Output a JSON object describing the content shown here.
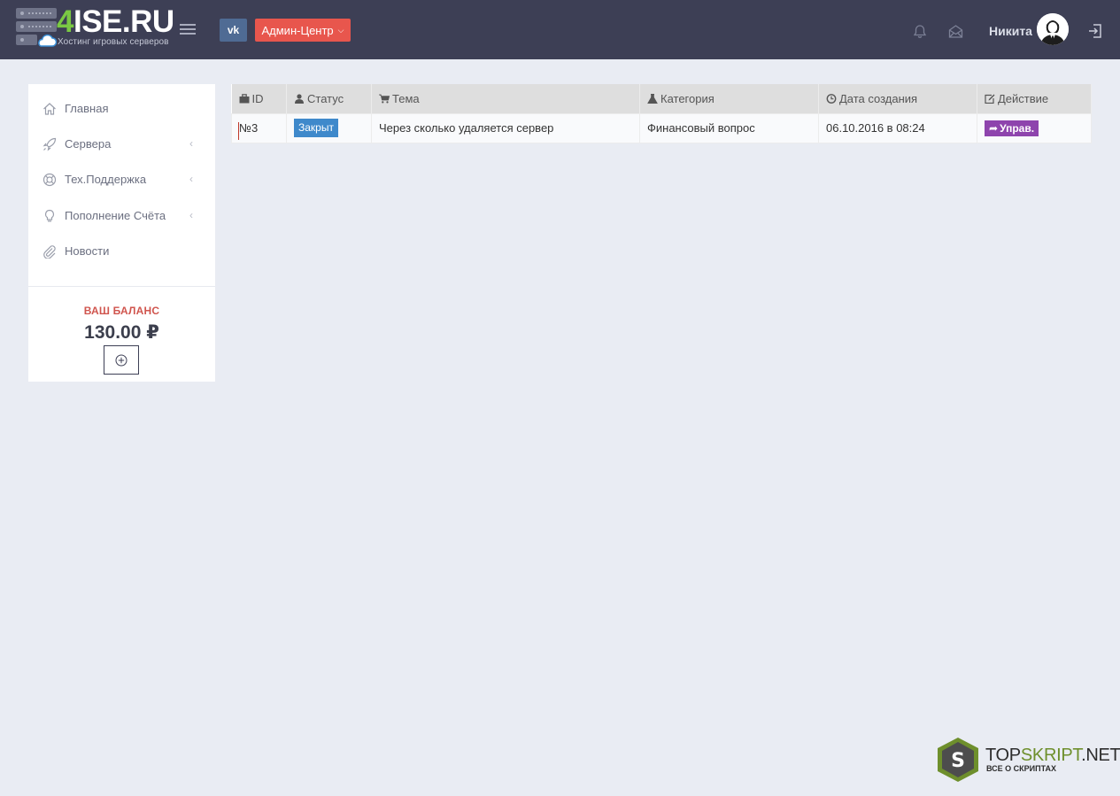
{
  "header": {
    "logo": {
      "brand_four": "4",
      "brand_rest": "ISE.RU",
      "tagline": "Хостинг игровых серверов"
    },
    "vk_label": "vk",
    "admin_label": "Админ-Центр",
    "username": "Никита"
  },
  "sidebar": {
    "items": [
      {
        "label": "Главная",
        "icon": "home-icon",
        "has_arrow": false
      },
      {
        "label": "Сервера",
        "icon": "rocket-icon",
        "has_arrow": true
      },
      {
        "label": "Тех.Поддержка",
        "icon": "lifebuoy-icon",
        "has_arrow": true
      },
      {
        "label": "Пополнение Счёта",
        "icon": "lightbulb-icon",
        "has_arrow": true
      },
      {
        "label": "Новости",
        "icon": "paperclip-icon",
        "has_arrow": false
      }
    ],
    "arrow_glyph": "‹",
    "balance_label": "ВАШ БАЛАНС",
    "balance_amount": "130.00 ₽",
    "add_glyph": "⊕"
  },
  "table": {
    "columns": [
      {
        "label": "ID",
        "icon": "briefcase-icon"
      },
      {
        "label": "Статус",
        "icon": "user-icon"
      },
      {
        "label": "Тема",
        "icon": "cart-icon"
      },
      {
        "label": "Категория",
        "icon": "flask-icon"
      },
      {
        "label": "Дата создания",
        "icon": "clock-icon"
      },
      {
        "label": "Действие",
        "icon": "edit-icon"
      }
    ],
    "rows": [
      {
        "id": "№3",
        "status": "Закрыт",
        "subject": "Через сколько удаляется сервер",
        "category": "Финансовый вопрос",
        "created": "06.10.2016 в 08:24",
        "action": "Управ."
      }
    ]
  },
  "watermark": {
    "title_main": "TOP",
    "title_accent": "SKRIPT",
    "title_end": ".NET",
    "subtitle": "ВСЕ О СКРИПТАХ",
    "badge_letter": "S"
  },
  "colors": {
    "header_bg": "#3d3f55",
    "admin_button": "#e8564d",
    "vk_button": "#4f6b94",
    "status_closed": "#3f89cb",
    "action_button": "#8e44ad",
    "balance_label": "#d0554e",
    "logo_accent": "#7ac943"
  }
}
